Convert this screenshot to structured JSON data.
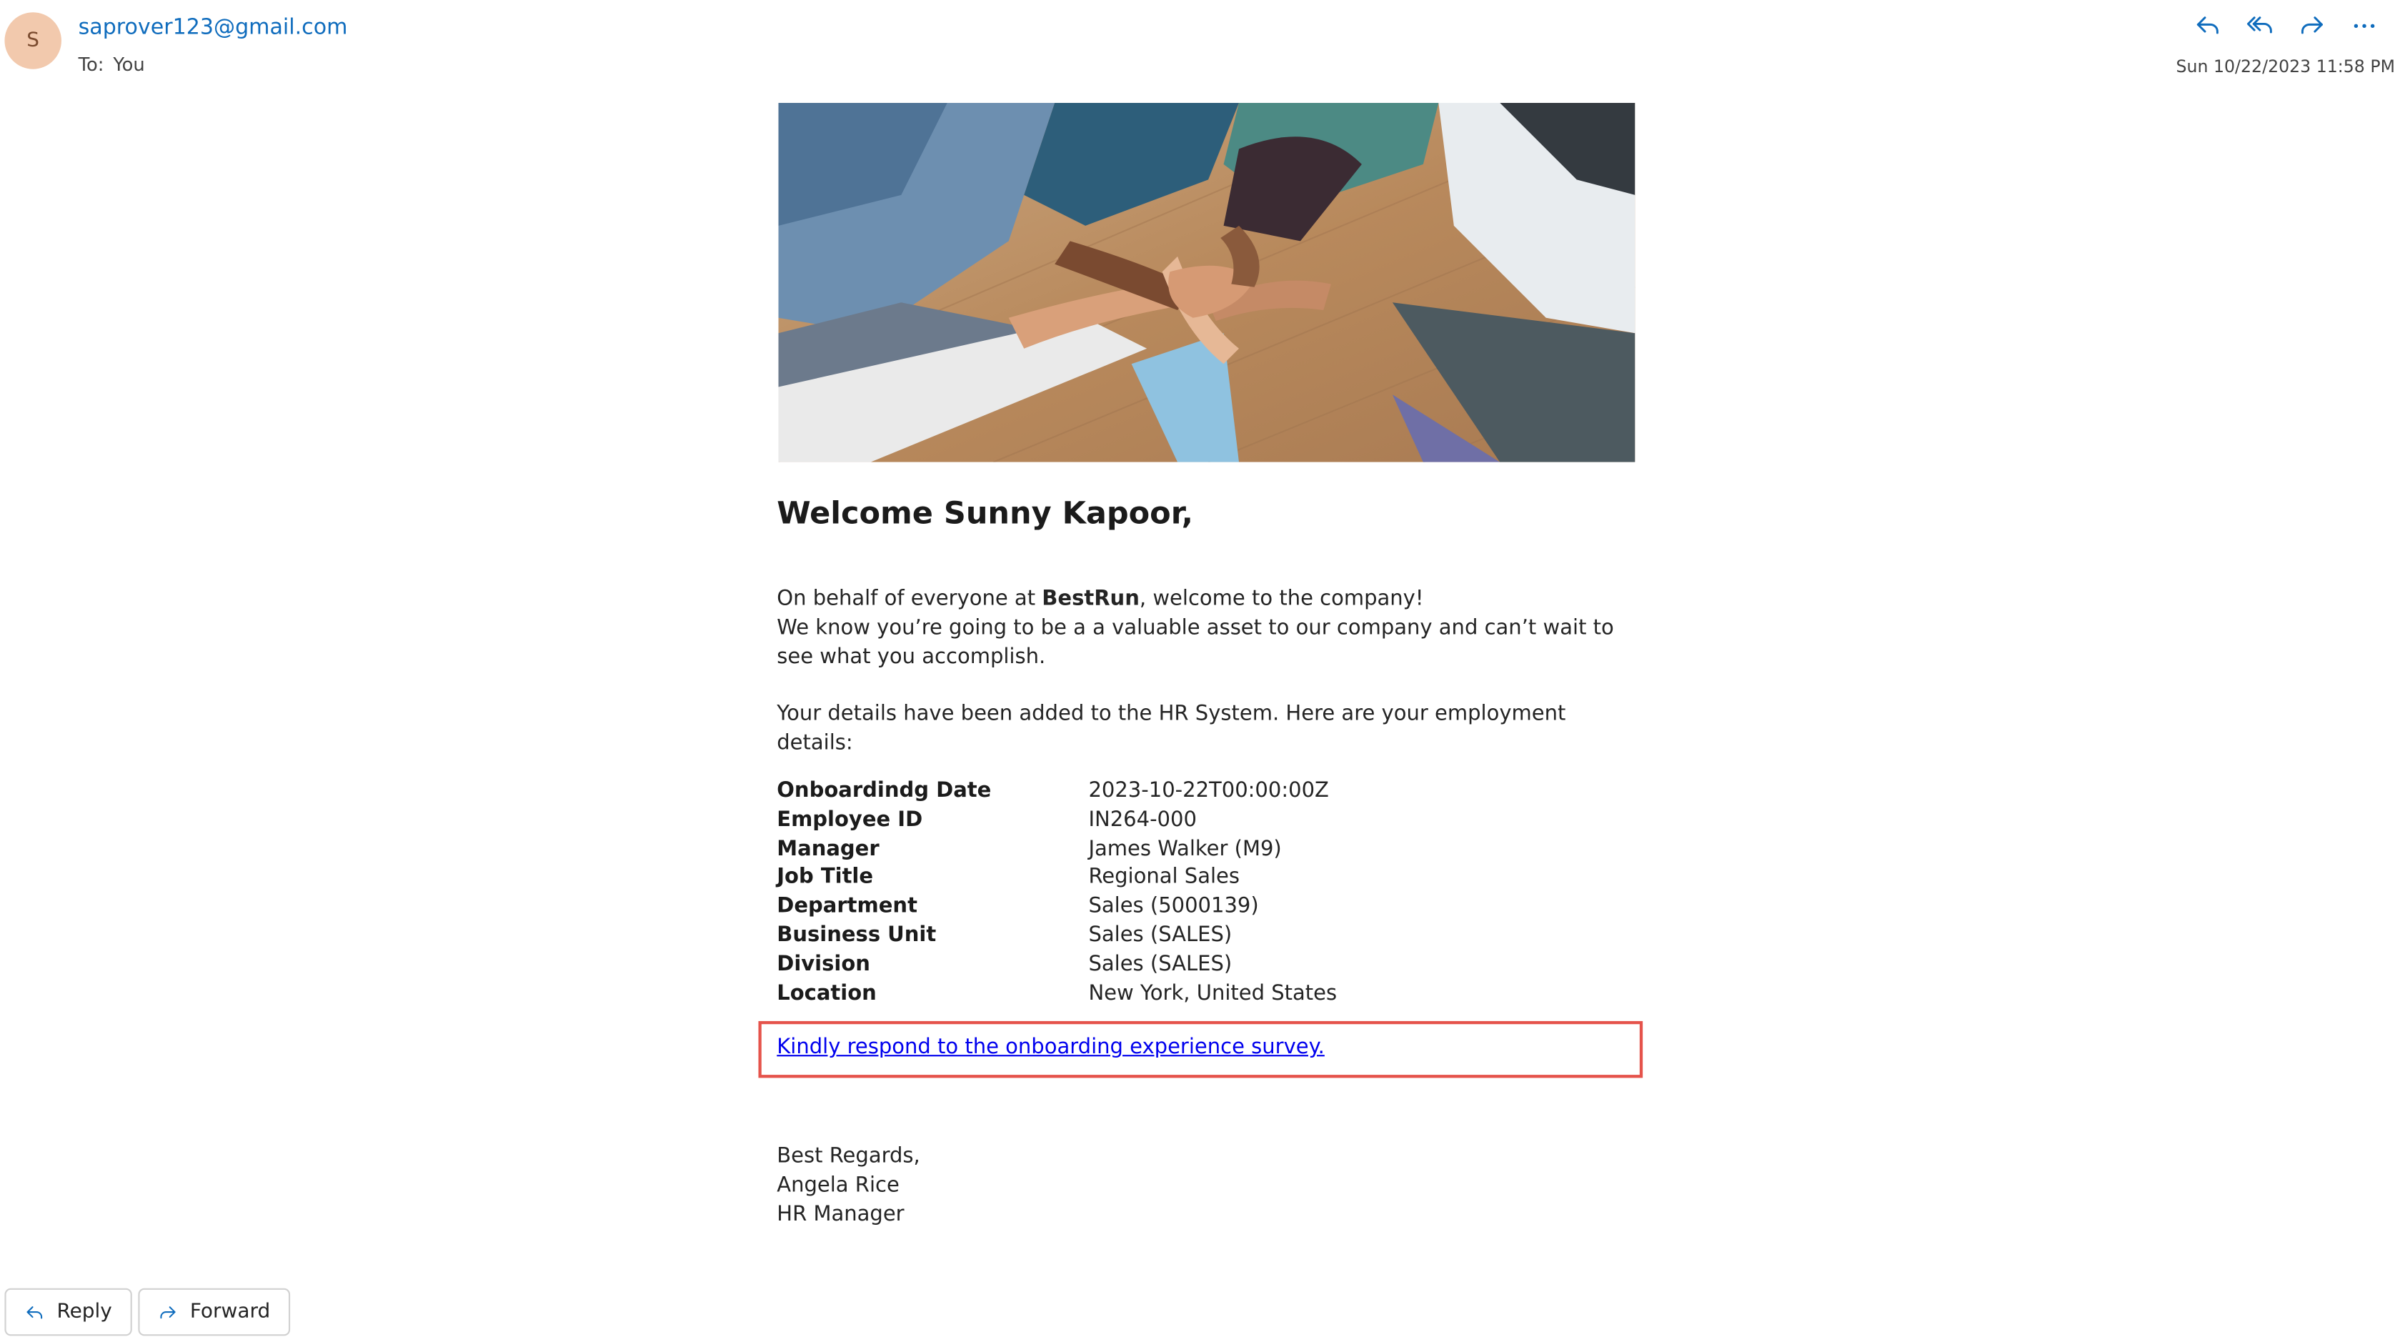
{
  "header": {
    "avatar_initial": "S",
    "sender_email": "saprover123@gmail.com",
    "to_label": "To:",
    "to_value": "You",
    "date": "Sun 10/22/2023 11:58 PM",
    "actions": [
      {
        "icon": "reply-icon"
      },
      {
        "icon": "reply-all-icon"
      },
      {
        "icon": "forward-icon"
      },
      {
        "icon": "more-options-icon"
      }
    ]
  },
  "body": {
    "greeting": "Welcome Sunny Kapoor,",
    "intro_prefix": "On behalf of everyone at ",
    "company": "BestRun",
    "intro_suffix": ", welcome to the company!",
    "intro_line2": "We know you’re going to be a a valuable asset to our company and can’t wait to see what you accomplish.",
    "details_intro": "Your details have been added to the HR System. Here are your employment details:",
    "details": [
      {
        "label": "Onboardindg Date",
        "value": "2023-10-22T00:00:00Z"
      },
      {
        "label": "Employee ID",
        "value": "IN264-000"
      },
      {
        "label": "Manager",
        "value": "James Walker (M9)"
      },
      {
        "label": "Job Title",
        "value": "Regional Sales"
      },
      {
        "label": "Department",
        "value": "Sales (5000139)"
      },
      {
        "label": "Business Unit",
        "value": "Sales (SALES)"
      },
      {
        "label": "Division",
        "value": "Sales (SALES)"
      },
      {
        "label": "Location",
        "value": "New York, United States"
      }
    ],
    "survey_link": "Kindly respond to the onboarding experience survey.",
    "signoff": "Best Regards,",
    "signer_name": "Angela Rice",
    "signer_title": "HR Manager"
  },
  "footer": {
    "reply_label": "Reply",
    "forward_label": "Forward"
  },
  "colors": {
    "link": "#0f6cbd",
    "survey_link": "#0000ee",
    "highlight_border": "#e5534b",
    "avatar_bg": "#f2c9ad"
  }
}
